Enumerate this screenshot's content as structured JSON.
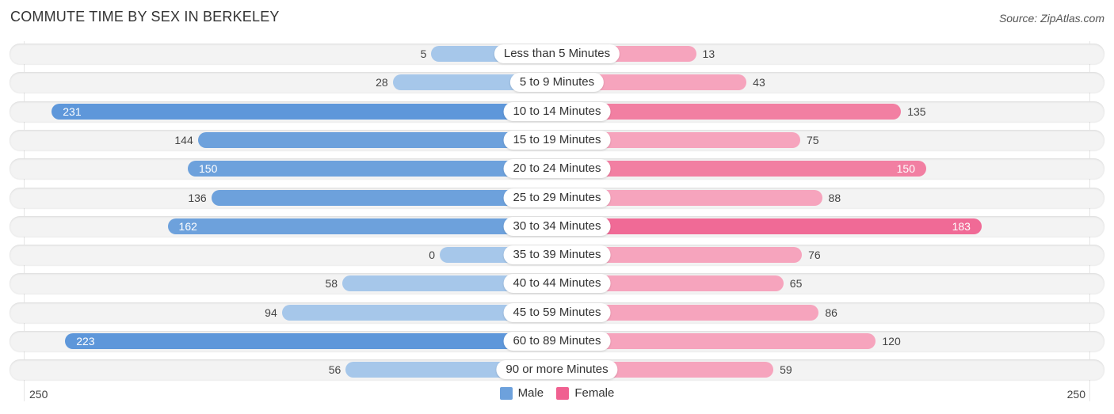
{
  "header": {
    "title": "COMMUTE TIME BY SEX IN BERKELEY",
    "source": "Source: ZipAtlas.com"
  },
  "colors": {
    "male": "#6da1dc",
    "male_light": "#a6c7ea",
    "female": "#f27fa2",
    "female_light": "#f6a4bd"
  },
  "chart_data": {
    "type": "bar",
    "orientation": "horizontal-diverging",
    "title": "COMMUTE TIME BY SEX IN BERKELEY",
    "categories": [
      "Less than 5 Minutes",
      "5 to 9 Minutes",
      "10 to 14 Minutes",
      "15 to 19 Minutes",
      "20 to 24 Minutes",
      "25 to 29 Minutes",
      "30 to 34 Minutes",
      "35 to 39 Minutes",
      "40 to 44 Minutes",
      "45 to 59 Minutes",
      "60 to 89 Minutes",
      "90 or more Minutes"
    ],
    "series": [
      {
        "name": "Male",
        "values": [
          5,
          28,
          231,
          144,
          150,
          136,
          162,
          0,
          58,
          94,
          223,
          56
        ]
      },
      {
        "name": "Female",
        "values": [
          13,
          43,
          135,
          75,
          150,
          88,
          183,
          76,
          65,
          86,
          120,
          59
        ]
      }
    ],
    "axis": {
      "left_max_label": "250",
      "right_max_label": "250",
      "max": 250
    },
    "legend": {
      "position": "bottom-center",
      "items": [
        "Male",
        "Female"
      ]
    },
    "grid": false
  }
}
